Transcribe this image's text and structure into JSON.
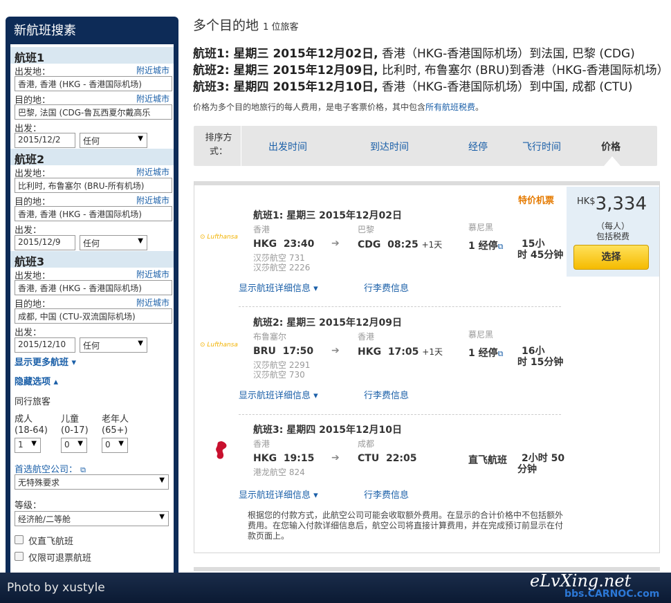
{
  "sidebar": {
    "title": "新航班搜素",
    "legs": [
      {
        "title": "航班1",
        "from_label": "出发地：",
        "from_value": "香港, 香港 (HKG - 香港国际机场)",
        "to_label": "目的地：",
        "to_value": "巴黎, 法国 (CDG-鲁瓦西夏尔戴高乐",
        "date_label": "出发：",
        "date_value": "2015/12/2",
        "time_value": "任何",
        "nearby": "附近城市"
      },
      {
        "title": "航班2",
        "from_label": "出发地：",
        "from_value": "比利时, 布鲁塞尔 (BRU-所有机场)",
        "to_label": "目的地：",
        "to_value": "香港, 香港 (HKG - 香港国际机场)",
        "date_label": "出发：",
        "date_value": "2015/12/9",
        "time_value": "任何",
        "nearby": "附近城市"
      },
      {
        "title": "航班3",
        "from_label": "出发地：",
        "from_value": "香港, 香港 (HKG - 香港国际机场)",
        "to_label": "目的地：",
        "to_value": "成都, 中国 (CTU-双流国际机场)",
        "date_label": "出发：",
        "date_value": "2015/12/10",
        "time_value": "任何",
        "nearby": "附近城市"
      }
    ],
    "more_flights": "显示更多航班 ▾",
    "hide_options": "隐藏选项 ▴",
    "travelers_label": "同行旅客",
    "pax": [
      {
        "label": "成人",
        "range": "(18-64)",
        "value": "1"
      },
      {
        "label": "儿童",
        "range": "(0-17)",
        "value": "0"
      },
      {
        "label": "老年人",
        "range": "(65+)",
        "value": "0"
      }
    ],
    "airline_pref_label": "首选航空公司：",
    "airline_pref_value": "无特殊要求",
    "class_label": "等级：",
    "class_value": "经济舱/二等舱",
    "nonstop_label": "仅直飞航班",
    "refundable_label": "仅限可退票航班"
  },
  "main": {
    "title": "多个目的地",
    "travelers": "1 位旅客",
    "summaries": [
      {
        "head": "航班1: 星期三 2015年12月02日,",
        "rest": " 香港（HKG-香港国际机场）到法国, 巴黎 (CDG)"
      },
      {
        "head": "航班2: 星期三 2015年12月09日,",
        "rest": " 比利时, 布鲁塞尔 (BRU)到香港（HKG-香港国际机场）"
      },
      {
        "head": "航班3: 星期四 2015年12月10日,",
        "rest": " 香港（HKG-香港国际机场）到中国, 成都 (CTU)"
      }
    ],
    "price_note": "价格为多个目的地旅行的每人费用，是电子客票价格，其中包含",
    "price_note_link": "所有航班税费",
    "price_note_end": "。",
    "sort": {
      "label": "排序方式：",
      "items": [
        "出发时间",
        "到达时间",
        "经停",
        "飞行时间",
        "价格"
      ]
    }
  },
  "result": {
    "special": "特价机票",
    "currency": "HK$",
    "price": "3,334",
    "per_person": "（每人）",
    "tax_incl": "包括税费",
    "select": "选择",
    "legs": [
      {
        "airline": "Lufthansa",
        "title": "航班1:  星期三 2015年12月02日",
        "dep_city": "香港",
        "dep_code": "HKG",
        "dep_time": "23:40",
        "arr_city": "巴黎",
        "arr_code": "CDG",
        "arr_time": "08:25",
        "plus": "+1天",
        "flight_nos": [
          "汉莎航空 731",
          "汉莎航空 2226"
        ],
        "via": "慕尼黑",
        "stops": "1 经停",
        "duration_a": "15小",
        "duration_b": "时 45分钟"
      },
      {
        "airline": "Lufthansa",
        "title": "航班2:  星期三 2015年12月09日",
        "dep_city": "布鲁塞尔",
        "dep_code": "BRU",
        "dep_time": "17:50",
        "arr_city": "香港",
        "arr_code": "HKG",
        "arr_time": "17:05",
        "plus": "+1天",
        "flight_nos": [
          "汉莎航空 2291",
          "汉莎航空 730"
        ],
        "via": "慕尼黑",
        "stops": "1 经停",
        "duration_a": "16小",
        "duration_b": "时 15分钟"
      },
      {
        "airline": "Dragonair",
        "title": "航班3:  星期四 2015年12月10日",
        "dep_city": "香港",
        "dep_code": "HKG",
        "dep_time": "19:15",
        "arr_city": "成都",
        "arr_code": "CTU",
        "arr_time": "22:05",
        "plus": "",
        "flight_nos": [
          "港龙航空 824"
        ],
        "via": "",
        "stops": "直飞航班",
        "duration_a": "2小时 50",
        "duration_b": "分钟"
      }
    ],
    "detail_link": "显示航班详细信息 ▾",
    "bag_link": "行李费信息",
    "fee_note": "根据您的付款方式，此航空公司可能会收取额外费用。在显示的合计价格中不包括额外费用。在您输入付款详细信息后，航空公司将直接计算费用，并在完成预订前显示在付款页面上。"
  },
  "footer": {
    "photo_by": "Photo by xustyle",
    "watermark1": "eLvXing.net",
    "watermark2": "bbs.CARNOC.com"
  }
}
